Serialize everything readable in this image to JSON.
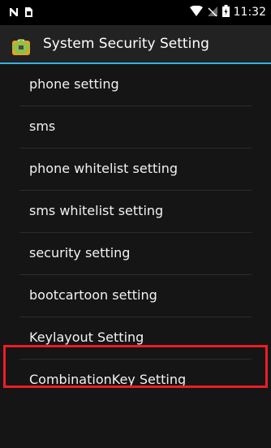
{
  "status_bar": {
    "time": "11:32",
    "left_icons": [
      "nfc-icon",
      "sim-card-icon"
    ],
    "right_icons": [
      "wifi-icon",
      "no-signal-icon",
      "battery-icon"
    ]
  },
  "action_bar": {
    "title": "System Security Setting",
    "icon": "android-icon"
  },
  "list": {
    "items": [
      {
        "label": "phone setting"
      },
      {
        "label": "sms"
      },
      {
        "label": "phone whitelist setting"
      },
      {
        "label": "sms whitelist setting"
      },
      {
        "label": "security setting"
      },
      {
        "label": "bootcartoon setting"
      },
      {
        "label": "Keylayout Setting"
      },
      {
        "label": "CombinationKey Setting"
      }
    ]
  },
  "colors": {
    "background": "#151515",
    "action_bar": "#222222",
    "accent_line": "#33b5e5",
    "highlight": "#ee1c25",
    "text": "#f2f2f2"
  }
}
